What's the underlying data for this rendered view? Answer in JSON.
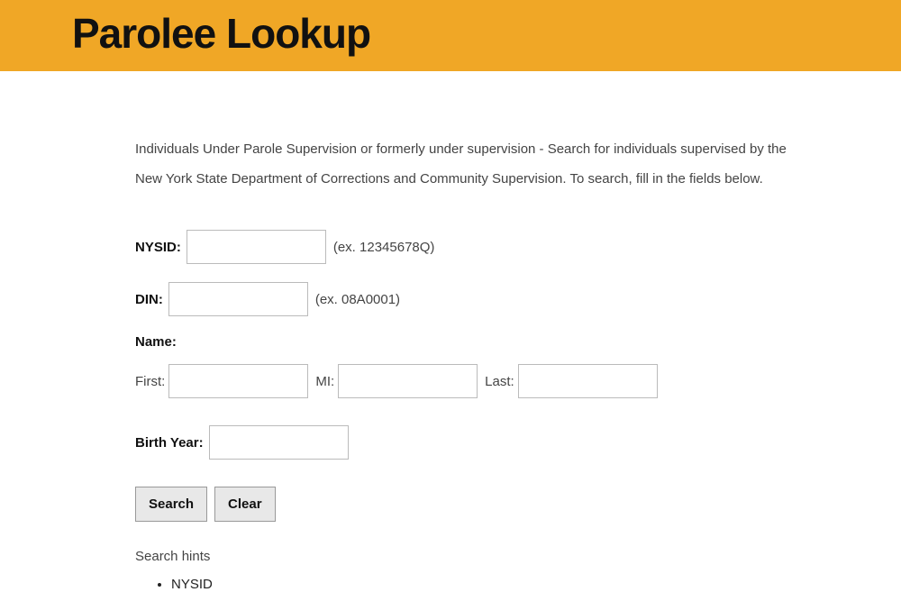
{
  "header": {
    "title": "Parolee Lookup"
  },
  "description": "Individuals Under Parole Supervision or formerly under supervision - Search for individuals supervised by the New York State Department of Corrections and Community Supervision. To search, fill in the fields below.",
  "form": {
    "nysid": {
      "label": "NYSID:",
      "hint": "(ex. 12345678Q)"
    },
    "din": {
      "label": "DIN:",
      "hint": "(ex. 08A0001)"
    },
    "name": {
      "label": "Name:",
      "first_label": "First:",
      "mi_label": "MI:",
      "last_label": "Last:"
    },
    "birth_year": {
      "label": "Birth Year:"
    }
  },
  "buttons": {
    "search": "Search",
    "clear": "Clear"
  },
  "hints": {
    "title": "Search hints",
    "items": [
      "NYSID"
    ]
  }
}
